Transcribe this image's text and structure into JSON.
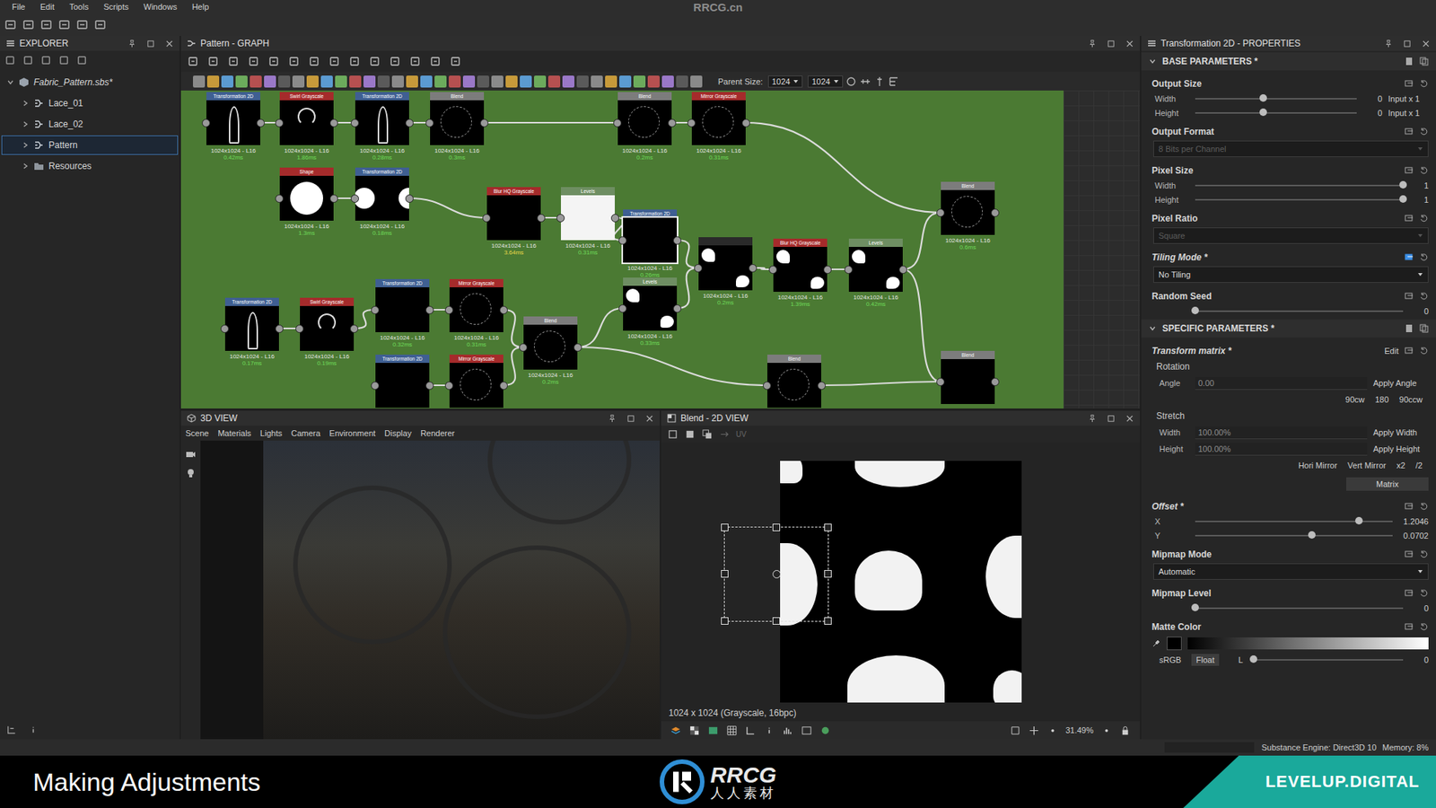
{
  "menubar": {
    "items": [
      "File",
      "Edit",
      "Tools",
      "Scripts",
      "Windows",
      "Help"
    ],
    "watermark": "RRCG.cn"
  },
  "explorer": {
    "title": "EXPLORER",
    "tree": [
      {
        "label": "Fabric_Pattern.sbs*",
        "kind": "package",
        "depth": 0,
        "expanded": true,
        "selected": false
      },
      {
        "label": "Lace_01",
        "kind": "graph",
        "depth": 1,
        "expanded": false,
        "selected": false
      },
      {
        "label": "Lace_02",
        "kind": "graph",
        "depth": 1,
        "expanded": false,
        "selected": false
      },
      {
        "label": "Pattern",
        "kind": "graph",
        "depth": 1,
        "expanded": false,
        "selected": true
      },
      {
        "label": "Resources",
        "kind": "folder",
        "depth": 1,
        "expanded": false,
        "selected": false
      }
    ]
  },
  "graph": {
    "title": "Pattern - GRAPH",
    "parent_size_label": "Parent Size:",
    "parent_size": [
      "1024",
      "1024"
    ],
    "nodes": [
      {
        "title": "Transformation 2D",
        "color": "#3f5f92",
        "thumb": "stroke",
        "size": "1024x1024 - L16",
        "time": "0.42ms",
        "time_color": "#6fdc5a",
        "selected": false
      },
      {
        "title": "Swirl Grayscale",
        "color": "#a52b2b",
        "thumb": "swirl",
        "size": "1024x1024 - L16",
        "time": "1.86ms",
        "time_color": "#6fdc5a",
        "selected": false
      },
      {
        "title": "Transformation 2D",
        "color": "#3f5f92",
        "thumb": "stroke",
        "size": "1024x1024 - L16",
        "time": "0.28ms",
        "time_color": "#6fdc5a",
        "selected": false
      },
      {
        "title": "Blend",
        "color": "#7c7c7c",
        "thumb": "lace",
        "size": "1024x1024 - L16",
        "time": "0.3ms",
        "time_color": "#6fdc5a",
        "selected": false
      },
      {
        "title": "Blend",
        "color": "#7c7c7c",
        "thumb": "lace",
        "size": "1024x1024 - L16",
        "time": "0.2ms",
        "time_color": "#6fdc5a",
        "selected": false
      },
      {
        "title": "Mirror Grayscale",
        "color": "#a52b2b",
        "thumb": "lace",
        "size": "1024x1024 - L16",
        "time": "0.31ms",
        "time_color": "#6fdc5a",
        "selected": false
      },
      {
        "title": "Shape",
        "color": "#a52b2b",
        "thumb": "circle",
        "size": "1024x1024 - L16",
        "time": "1.3ms",
        "time_color": "#6fdc5a",
        "selected": false
      },
      {
        "title": "Transformation 2D",
        "color": "#3f5f92",
        "thumb": "circles",
        "size": "1024x1024 - L16",
        "time": "0.18ms",
        "time_color": "#6fdc5a",
        "selected": false
      },
      {
        "title": "Blur HQ Grayscale",
        "color": "#a52b2b",
        "thumb": "dark",
        "size": "1024x1024 - L16",
        "time": "3.64ms",
        "time_color": "#e8d84a",
        "selected": false
      },
      {
        "title": "Levels",
        "color": "#6e8e62",
        "thumb": "white",
        "size": "1024x1024 - L16",
        "time": "0.31ms",
        "time_color": "#6fdc5a",
        "selected": false
      },
      {
        "title": "Transformation 2D",
        "color": "#3f5f92",
        "thumb": "dark",
        "size": "1024x1024 - L16",
        "time": "0.26ms",
        "time_color": "#6fdc5a",
        "selected": true
      },
      {
        "title": "Levels",
        "color": "#6e8e62",
        "thumb": "flower",
        "size": "1024x1024 - L16",
        "time": "0.33ms",
        "time_color": "#6fdc5a",
        "selected": false
      },
      {
        "color": "#2a2a2a",
        "thumb": "flower",
        "size": "1024x1024 - L16",
        "time": "0.2ms",
        "time_color": "#6fdc5a",
        "selected": false
      },
      {
        "title": "Blur HQ Grayscale",
        "color": "#a52b2b",
        "thumb": "flower",
        "size": "1024x1024 - L16",
        "time": "1.39ms",
        "time_color": "#6fdc5a",
        "selected": false
      },
      {
        "title": "Levels",
        "color": "#6e8e62",
        "thumb": "flower",
        "size": "1024x1024 - L16",
        "time": "0.42ms",
        "time_color": "#6fdc5a",
        "selected": false
      },
      {
        "title": "Blend",
        "color": "#7c7c7c",
        "thumb": "lace",
        "size": "1024x1024 - L16",
        "time": "0.6ms",
        "time_color": "#6fdc5a",
        "selected": false
      },
      {
        "title": "Transformation 2D",
        "color": "#3f5f92",
        "thumb": "stroke",
        "size": "1024x1024 - L16",
        "time": "0.17ms",
        "time_color": "#6fdc5a",
        "selected": false
      },
      {
        "title": "Swirl Grayscale",
        "color": "#a52b2b",
        "thumb": "swirl",
        "size": "1024x1024 - L16",
        "time": "0.19ms",
        "time_color": "#6fdc5a",
        "selected": false
      },
      {
        "title": "Transformation 2D",
        "color": "#3f5f92",
        "thumb": "dark",
        "size": "1024x1024 - L16",
        "time": "0.32ms",
        "time_color": "#6fdc5a",
        "selected": false
      },
      {
        "title": "Mirror Grayscale",
        "color": "#a52b2b",
        "thumb": "lace",
        "size": "1024x1024 - L16",
        "time": "0.31ms",
        "time_color": "#6fdc5a",
        "selected": false
      },
      {
        "title": "Blend",
        "color": "#7c7c7c",
        "thumb": "lace",
        "size": "1024x1024 - L16",
        "time": "0.2ms",
        "time_color": "#6fdc5a",
        "selected": false
      },
      {
        "title": "Transformation 2D",
        "color": "#3f5f92",
        "thumb": "dark",
        "selected": false
      },
      {
        "title": "Mirror Grayscale",
        "color": "#a52b2b",
        "thumb": "lace",
        "selected": false
      },
      {
        "title": "Blend",
        "color": "#7c7c7c",
        "thumb": "lace",
        "selected": false
      },
      {
        "title": "Blend",
        "color": "#7c7c7c",
        "thumb": "dark",
        "selected": false
      }
    ],
    "links": [
      [
        0,
        1
      ],
      [
        1,
        2
      ],
      [
        2,
        3
      ],
      [
        3,
        4
      ],
      [
        4,
        5
      ],
      [
        6,
        7
      ],
      [
        7,
        8
      ],
      [
        8,
        9
      ],
      [
        9,
        10
      ],
      [
        10,
        12
      ],
      [
        11,
        12
      ],
      [
        12,
        13
      ],
      [
        13,
        14
      ],
      [
        14,
        15
      ],
      [
        5,
        15
      ],
      [
        16,
        17
      ],
      [
        17,
        18
      ],
      [
        18,
        19
      ],
      [
        19,
        20
      ],
      [
        20,
        11
      ],
      [
        21,
        22
      ],
      [
        22,
        20
      ],
      [
        20,
        23
      ],
      [
        23,
        24
      ],
      [
        14,
        24
      ]
    ]
  },
  "view3d": {
    "title": "3D VIEW",
    "menus": [
      "Scene",
      "Materials",
      "Lights",
      "Camera",
      "Environment",
      "Display",
      "Renderer"
    ]
  },
  "view2d": {
    "title": "Blend - 2D VIEW",
    "uv": "UV",
    "info": "1024 x 1024 (Grayscale, 16bpc)",
    "zoom": "31.49%"
  },
  "properties": {
    "title": "Transformation 2D - PROPERTIES",
    "rows": [
      {
        "kind": "section",
        "label": "BASE PARAMETERS *",
        "expanded": true
      },
      {
        "kind": "header",
        "label": "Output Size",
        "modified": false,
        "linked": false
      },
      {
        "kind": "slider",
        "label": "Width",
        "level": 0.42,
        "value": "0",
        "suffix": "Input x 1"
      },
      {
        "kind": "slider",
        "label": "Height",
        "level": 0.42,
        "value": "0",
        "suffix": "Input x 1"
      },
      {
        "kind": "header",
        "label": "Output Format",
        "modified": false,
        "linked": false
      },
      {
        "kind": "dropdown",
        "value": "8 Bits per Channel",
        "disabled": true
      },
      {
        "kind": "header",
        "label": "Pixel Size",
        "modified": false,
        "linked": false
      },
      {
        "kind": "slider",
        "label": "Width",
        "level": 1,
        "value": "1"
      },
      {
        "kind": "slider",
        "label": "Height",
        "level": 1,
        "value": "1"
      },
      {
        "kind": "header",
        "label": "Pixel Ratio",
        "modified": false,
        "linked": false
      },
      {
        "kind": "dropdown",
        "value": "Square",
        "disabled": true
      },
      {
        "kind": "header",
        "label": "Tiling Mode *",
        "modified": true,
        "linked": true
      },
      {
        "kind": "dropdown",
        "value": "No Tiling",
        "disabled": false
      },
      {
        "kind": "header",
        "label": "Random Seed",
        "modified": false,
        "linked": false
      },
      {
        "kind": "slider",
        "level": 0,
        "value": "0"
      },
      {
        "kind": "section",
        "label": "SPECIFIC PARAMETERS *",
        "expanded": true
      },
      {
        "kind": "header",
        "label": "Transform matrix *",
        "modified": true,
        "linked": false,
        "action": "Edit"
      },
      {
        "kind": "text",
        "label": "Rotation"
      },
      {
        "kind": "field",
        "label": "Angle",
        "value": "0.00",
        "action": "Apply Angle"
      },
      {
        "kind": "buttons",
        "items": [
          "90cw",
          "180",
          "90ccw"
        ]
      },
      {
        "kind": "text",
        "label": "Stretch"
      },
      {
        "kind": "field",
        "label": "Width",
        "value": "100.00%",
        "action": "Apply Width"
      },
      {
        "kind": "field",
        "label": "Height",
        "value": "100.00%",
        "action": "Apply Height"
      },
      {
        "kind": "buttons",
        "items": [
          "Hori Mirror",
          "Vert Mirror",
          "x2",
          "/2"
        ]
      },
      {
        "kind": "button",
        "label": "Matrix"
      },
      {
        "kind": "header",
        "label": "Offset *",
        "modified": true,
        "linked": false
      },
      {
        "kind": "slider",
        "label": "X",
        "level": 0.83,
        "value": "1.2046"
      },
      {
        "kind": "slider",
        "label": "Y",
        "level": 0.59,
        "value": "0.0702"
      },
      {
        "kind": "header",
        "label": "Mipmap Mode",
        "modified": false,
        "linked": false
      },
      {
        "kind": "dropdown",
        "value": "Automatic",
        "disabled": false
      },
      {
        "kind": "header",
        "label": "Mipmap Level",
        "modified": false,
        "linked": false
      },
      {
        "kind": "slider",
        "level": 0,
        "value": "0"
      },
      {
        "kind": "header",
        "label": "Matte Color",
        "modified": false,
        "linked": false
      },
      {
        "kind": "color",
        "color": "#000000"
      },
      {
        "kind": "format",
        "items": [
          {
            "label": "sRGB",
            "selected": false
          },
          {
            "label": "Float",
            "selected": true
          }
        ],
        "channel": "L",
        "level": 0,
        "value": "0"
      }
    ]
  },
  "status_bar": {
    "engine": "Substance Engine: Direct3D 10",
    "memory": "Memory: 8%"
  },
  "caption": {
    "title": "Making Adjustments",
    "logo_main": "RRCG",
    "logo_sub": "人人素材",
    "brand": "LEVELUP.DIGITAL"
  }
}
